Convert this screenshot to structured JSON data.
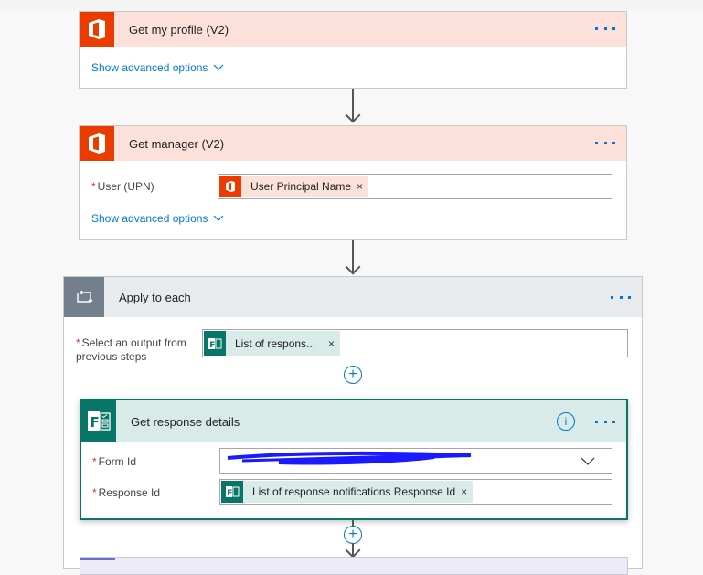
{
  "steps": {
    "profile": {
      "title": "Get my profile (V2)",
      "advanced_label": "Show advanced options",
      "icon": "office-icon"
    },
    "manager": {
      "title": "Get manager (V2)",
      "advanced_label": "Show advanced options",
      "icon": "office-icon",
      "fields": [
        {
          "label": "User (UPN)",
          "required": "*",
          "token": "User Principal Name",
          "remove": "×"
        }
      ]
    },
    "apply_each": {
      "title": "Apply to each",
      "icon": "loop-icon",
      "fields": [
        {
          "label": "Select an output from previous steps",
          "required": "*",
          "token": "List of respons...",
          "remove": "×"
        }
      ]
    },
    "response_details": {
      "title": "Get response details",
      "icon": "forms-icon",
      "fields": [
        {
          "label": "Form Id",
          "required": "*",
          "value": "[redacted]"
        },
        {
          "label": "Response Id",
          "required": "*",
          "token": "List of response notifications Response Id",
          "remove": "×"
        }
      ]
    }
  },
  "more_label": "...",
  "add_symbol": "+",
  "colors": {
    "office_brand": "#eb3c00",
    "office_header": "#fce1da",
    "forms_brand": "#077568",
    "forms_header": "#d8ebe8",
    "loop_brand": "#737f8c",
    "loop_header": "#e8ebee",
    "link": "#0078d4"
  }
}
